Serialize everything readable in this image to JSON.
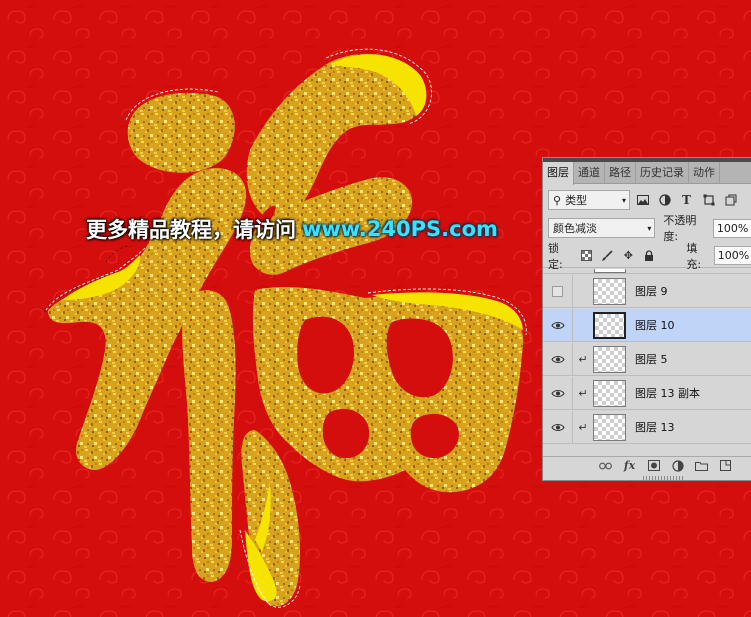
{
  "canvas": {
    "character": "福",
    "background_color": "#d40d0d",
    "gold_color": "#d9a51c",
    "highlight_color": "#f6e400"
  },
  "watermark": {
    "cn_text": "更多精品教程，请访问",
    "url_text": "www.240PS.com"
  },
  "layers_panel": {
    "tabs": [
      "图层",
      "通道",
      "路径",
      "历史记录",
      "动作"
    ],
    "active_tab": "图层",
    "filter": {
      "kind_label": "类型",
      "icons": [
        "image-filter-icon",
        "adjustment-filter-icon",
        "type-filter-icon",
        "shape-filter-icon",
        "smart-object-filter-icon"
      ]
    },
    "blend_mode": "颜色减淡",
    "opacity_label": "不透明度:",
    "opacity_value": "100%",
    "lock_label": "锁定:",
    "fill_label": "填充:",
    "fill_value": "100%",
    "layers": [
      {
        "name": "图层 9",
        "visible": false,
        "clipped": false,
        "selected": false
      },
      {
        "name": "图层 10",
        "visible": true,
        "clipped": false,
        "selected": true
      },
      {
        "name": "图层 5",
        "visible": true,
        "clipped": true,
        "selected": false
      },
      {
        "name": "图层 13 副本",
        "visible": true,
        "clipped": true,
        "selected": false
      },
      {
        "name": "图层 13",
        "visible": true,
        "clipped": true,
        "selected": false
      }
    ]
  }
}
